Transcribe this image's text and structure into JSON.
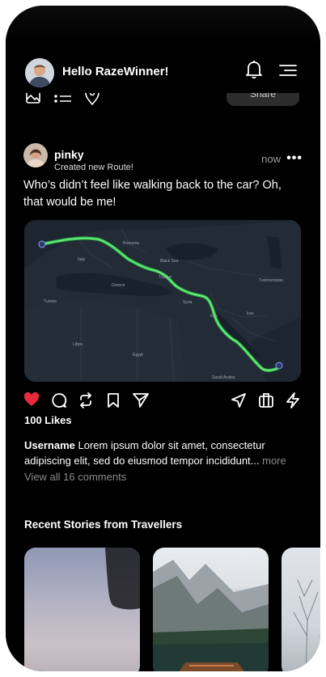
{
  "header": {
    "greeting": "Hello RazeWinner!",
    "notification_icon": "bell-icon",
    "menu_icon": "menu-icon"
  },
  "partial_row": {
    "share_label": "Share",
    "icons": [
      "image-icon",
      "list-icon",
      "location-pin-icon"
    ]
  },
  "post": {
    "username": "pinky",
    "action": "Created new Route!",
    "time": "now",
    "caption": "Who’s didn’t feel like walking back to the car? Oh, that would be me!",
    "likes": "100 Likes",
    "author": "Username",
    "description": "Lorem ipsum dolor sit amet, consectetur adipiscing elit, sed do eiusmod tempor incididunt...",
    "more": "more",
    "comments": "View all 16 comments",
    "liked": true,
    "map_labels": {
      "romania": "Romania",
      "black_sea": "Black Sea",
      "greece": "Greece",
      "turkiye": "Türkiye",
      "turkmenistan": "Turkmenistan",
      "tunisia": "Tunisia",
      "syria": "Syria",
      "iraq": "Iraq",
      "iran": "Iran",
      "libya": "Libya",
      "egypt": "Egypt",
      "saudi_arabia": "Saudi Arabia",
      "italy": "Italy"
    }
  },
  "stories": {
    "title": "Recent Stories from Travellers"
  },
  "colors": {
    "background": "#000000",
    "like": "#e8293d",
    "route": "#2ecc4a",
    "muted": "#8a8a8a"
  }
}
